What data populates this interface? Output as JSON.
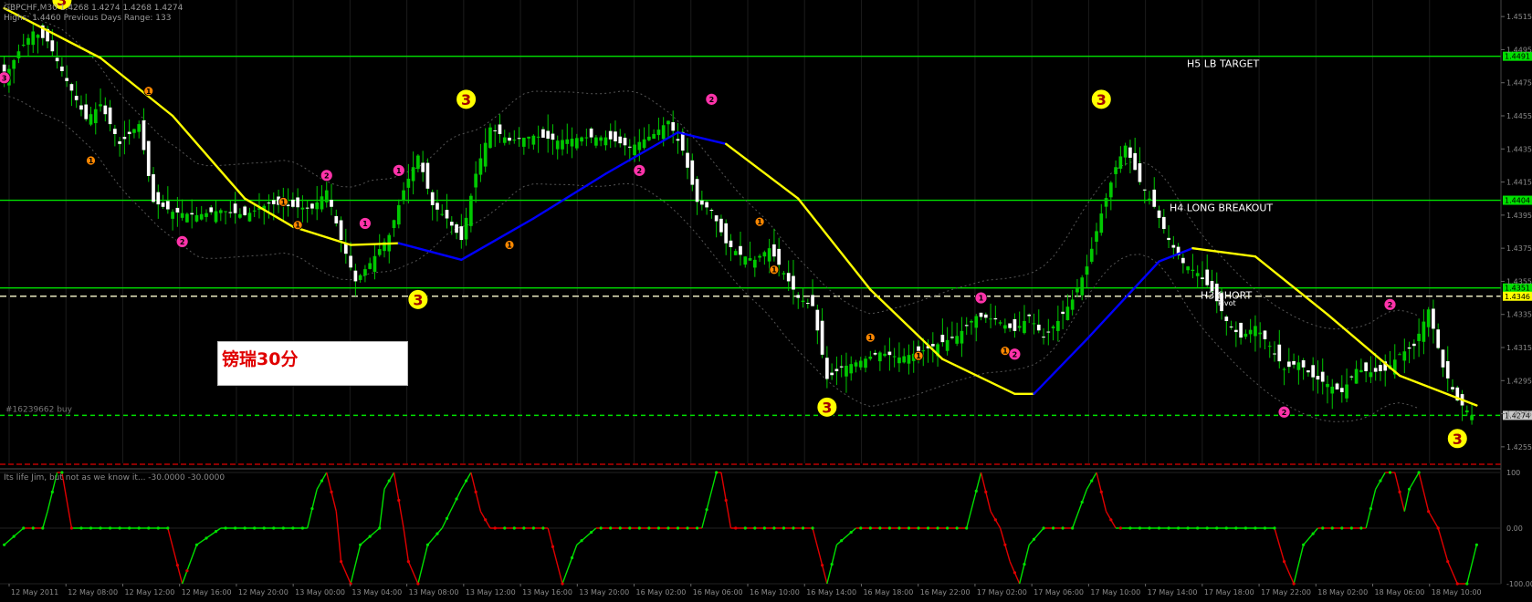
{
  "header": {
    "symbol_line": "GBPCHF,M30 1.4268 1.4274 1.4268 1.4274",
    "info_line": "Highs: 1.4460 Previous Days Range: 133"
  },
  "colors": {
    "background": "#000000",
    "bull_candle": "#00c800",
    "bear_candle": "#ffffff",
    "level_line": "#00e000",
    "ma_up": "#ffff00",
    "ma_down": "#0000ff",
    "osc_up": "#00e000",
    "osc_down": "#e00000",
    "signal_badge": "#ffff00",
    "arrow_pink": "#ff33aa",
    "arrow_orange": "#ff8800",
    "label_text": "#e00000"
  },
  "levels": {
    "h5": {
      "label": "H5 LB TARGET",
      "price": 1.4491,
      "price_text": "1.4491"
    },
    "h4": {
      "label": "H4 LONG BREAKOUT",
      "price": 1.4404,
      "price_text": "1.4404"
    },
    "h3": {
      "label": "H3 SHORT",
      "price": 1.4351,
      "price_text": "1.4351"
    },
    "pivot": {
      "label": "Pivot",
      "price": 1.4346,
      "price_text": "1.4346"
    },
    "order": {
      "label": "#16239662 buy",
      "price": 1.4274,
      "price_text": "1.4274"
    }
  },
  "label_box": {
    "text": "镑瑞30分"
  },
  "indicator": {
    "label": "Its life Jim, but not as we know it... -30.0000 -30.0000",
    "scale_labels": [
      "100",
      "0.00",
      "-100.00"
    ]
  },
  "chart_data": [
    {
      "type": "candlestick",
      "title": "GBPCHF,M30",
      "ylim": [
        1.4245,
        1.4525
      ],
      "y_ticks": [
        "1.4515",
        "1.4495",
        "1.4475",
        "1.4455",
        "1.4435",
        "1.4415",
        "1.4395",
        "1.4375",
        "1.4355",
        "1.4335",
        "1.4315",
        "1.4295",
        "1.4275",
        "1.4255"
      ],
      "y_tick_values": [
        1.4515,
        1.4495,
        1.4475,
        1.4455,
        1.4435,
        1.4415,
        1.4395,
        1.4375,
        1.4355,
        1.4335,
        1.4315,
        1.4295,
        1.4275,
        1.4255
      ],
      "x_tick_labels": [
        "12 May 2011",
        "12 May 08:00",
        "12 May 12:00",
        "12 May 16:00",
        "12 May 20:00",
        "13 May 00:00",
        "13 May 04:00",
        "13 May 08:00",
        "13 May 12:00",
        "13 May 16:00",
        "13 May 20:00",
        "16 May 02:00",
        "16 May 06:00",
        "16 May 10:00",
        "16 May 14:00",
        "16 May 18:00",
        "16 May 22:00",
        "17 May 02:00",
        "17 May 06:00",
        "17 May 10:00",
        "17 May 14:00",
        "17 May 18:00",
        "17 May 22:00",
        "18 May 02:00",
        "18 May 06:00",
        "18 May 10:00"
      ],
      "key_closes": [
        {
          "i": 0,
          "c": 1.4478
        },
        {
          "i": 3,
          "c": 1.4494
        },
        {
          "i": 6,
          "c": 1.4506
        },
        {
          "i": 9,
          "c": 1.45
        },
        {
          "i": 13,
          "c": 1.4476
        },
        {
          "i": 17,
          "c": 1.4453
        },
        {
          "i": 20,
          "c": 1.4462
        },
        {
          "i": 24,
          "c": 1.4438
        },
        {
          "i": 28,
          "c": 1.445
        },
        {
          "i": 31,
          "c": 1.4403
        },
        {
          "i": 35,
          "c": 1.4397
        },
        {
          "i": 40,
          "c": 1.4395
        },
        {
          "i": 45,
          "c": 1.4398
        },
        {
          "i": 50,
          "c": 1.4395
        },
        {
          "i": 55,
          "c": 1.4402
        },
        {
          "i": 60,
          "c": 1.44
        },
        {
          "i": 64,
          "c": 1.4399
        },
        {
          "i": 67,
          "c": 1.441
        },
        {
          "i": 70,
          "c": 1.438
        },
        {
          "i": 73,
          "c": 1.4355
        },
        {
          "i": 76,
          "c": 1.4366
        },
        {
          "i": 80,
          "c": 1.4383
        },
        {
          "i": 83,
          "c": 1.441
        },
        {
          "i": 86,
          "c": 1.4431
        },
        {
          "i": 89,
          "c": 1.4401
        },
        {
          "i": 92,
          "c": 1.4393
        },
        {
          "i": 95,
          "c": 1.438
        },
        {
          "i": 98,
          "c": 1.442
        },
        {
          "i": 101,
          "c": 1.4448
        },
        {
          "i": 105,
          "c": 1.444
        },
        {
          "i": 110,
          "c": 1.4443
        },
        {
          "i": 115,
          "c": 1.444
        },
        {
          "i": 120,
          "c": 1.4442
        },
        {
          "i": 125,
          "c": 1.4442
        },
        {
          "i": 130,
          "c": 1.4436
        },
        {
          "i": 135,
          "c": 1.4444
        },
        {
          "i": 138,
          "c": 1.4452
        },
        {
          "i": 141,
          "c": 1.4434
        },
        {
          "i": 144,
          "c": 1.4403
        },
        {
          "i": 147,
          "c": 1.4398
        },
        {
          "i": 150,
          "c": 1.4378
        },
        {
          "i": 153,
          "c": 1.4371
        },
        {
          "i": 156,
          "c": 1.4368
        },
        {
          "i": 159,
          "c": 1.4375
        },
        {
          "i": 162,
          "c": 1.436
        },
        {
          "i": 165,
          "c": 1.4345
        },
        {
          "i": 168,
          "c": 1.434
        },
        {
          "i": 171,
          "c": 1.4296
        },
        {
          "i": 174,
          "c": 1.4303
        },
        {
          "i": 178,
          "c": 1.4307
        },
        {
          "i": 182,
          "c": 1.4312
        },
        {
          "i": 186,
          "c": 1.4309
        },
        {
          "i": 190,
          "c": 1.4312
        },
        {
          "i": 194,
          "c": 1.4317
        },
        {
          "i": 198,
          "c": 1.4322
        },
        {
          "i": 202,
          "c": 1.4334
        },
        {
          "i": 206,
          "c": 1.4332
        },
        {
          "i": 210,
          "c": 1.4325
        },
        {
          "i": 213,
          "c": 1.4334
        },
        {
          "i": 216,
          "c": 1.4321
        },
        {
          "i": 219,
          "c": 1.4331
        },
        {
          "i": 222,
          "c": 1.4344
        },
        {
          "i": 225,
          "c": 1.4364
        },
        {
          "i": 228,
          "c": 1.4396
        },
        {
          "i": 231,
          "c": 1.4424
        },
        {
          "i": 233,
          "c": 1.4437
        },
        {
          "i": 236,
          "c": 1.4415
        },
        {
          "i": 239,
          "c": 1.44
        },
        {
          "i": 242,
          "c": 1.438
        },
        {
          "i": 245,
          "c": 1.4366
        },
        {
          "i": 248,
          "c": 1.436
        },
        {
          "i": 251,
          "c": 1.4349
        },
        {
          "i": 254,
          "c": 1.4331
        },
        {
          "i": 257,
          "c": 1.4321
        },
        {
          "i": 260,
          "c": 1.4328
        },
        {
          "i": 263,
          "c": 1.4316
        },
        {
          "i": 266,
          "c": 1.4302
        },
        {
          "i": 269,
          "c": 1.4306
        },
        {
          "i": 272,
          "c": 1.4297
        },
        {
          "i": 275,
          "c": 1.4293
        },
        {
          "i": 278,
          "c": 1.4288
        },
        {
          "i": 281,
          "c": 1.4302
        },
        {
          "i": 284,
          "c": 1.43
        },
        {
          "i": 287,
          "c": 1.4301
        },
        {
          "i": 290,
          "c": 1.4311
        },
        {
          "i": 293,
          "c": 1.4316
        },
        {
          "i": 296,
          "c": 1.4338
        },
        {
          "i": 299,
          "c": 1.4303
        },
        {
          "i": 302,
          "c": 1.4283
        },
        {
          "i": 305,
          "c": 1.4274
        }
      ],
      "n_bars": 307,
      "moving_average": [
        {
          "i": 0,
          "v": 1.452,
          "trend": "down"
        },
        {
          "i": 20,
          "v": 1.449,
          "trend": "down"
        },
        {
          "i": 35,
          "v": 1.4455,
          "trend": "down"
        },
        {
          "i": 50,
          "v": 1.4405,
          "trend": "down"
        },
        {
          "i": 60,
          "v": 1.4388,
          "trend": "down"
        },
        {
          "i": 72,
          "v": 1.4377,
          "trend": "down"
        },
        {
          "i": 82,
          "v": 1.4378,
          "trend": "up"
        },
        {
          "i": 95,
          "v": 1.4368,
          "trend": "up"
        },
        {
          "i": 110,
          "v": 1.4393,
          "trend": "up"
        },
        {
          "i": 125,
          "v": 1.442,
          "trend": "up"
        },
        {
          "i": 140,
          "v": 1.4445,
          "trend": "up"
        },
        {
          "i": 150,
          "v": 1.4438,
          "trend": "down"
        },
        {
          "i": 165,
          "v": 1.4405,
          "trend": "down"
        },
        {
          "i": 180,
          "v": 1.435,
          "trend": "down"
        },
        {
          "i": 195,
          "v": 1.4308,
          "trend": "down"
        },
        {
          "i": 210,
          "v": 1.4287,
          "trend": "down"
        },
        {
          "i": 214,
          "v": 1.4287,
          "trend": "up"
        },
        {
          "i": 225,
          "v": 1.432,
          "trend": "up"
        },
        {
          "i": 240,
          "v": 1.4367,
          "trend": "up"
        },
        {
          "i": 247,
          "v": 1.4375,
          "trend": "down"
        },
        {
          "i": 260,
          "v": 1.437,
          "trend": "down"
        },
        {
          "i": 275,
          "v": 1.4335,
          "trend": "down"
        },
        {
          "i": 290,
          "v": 1.4298,
          "trend": "down"
        },
        {
          "i": 306,
          "v": 1.428,
          "trend": "down"
        }
      ],
      "signals_3": [
        {
          "i": 12,
          "p": 1.4525,
          "side": "above"
        },
        {
          "i": 86,
          "p": 1.4344,
          "side": "below"
        },
        {
          "i": 96,
          "p": 1.4465,
          "side": "above"
        },
        {
          "i": 171,
          "p": 1.4279,
          "side": "below"
        },
        {
          "i": 228,
          "p": 1.4465,
          "side": "above"
        },
        {
          "i": 302,
          "p": 1.426,
          "side": "below"
        }
      ],
      "arrows": [
        {
          "i": 0,
          "p": 1.4478,
          "color": "pink",
          "label": "3"
        },
        {
          "i": 37,
          "p": 1.4379,
          "color": "pink",
          "label": "2"
        },
        {
          "i": 18,
          "p": 1.4428,
          "color": "orange",
          "label": "1"
        },
        {
          "i": 30,
          "p": 1.447,
          "color": "orange",
          "label": "1"
        },
        {
          "i": 58,
          "p": 1.4403,
          "color": "orange",
          "label": "1"
        },
        {
          "i": 61,
          "p": 1.4389,
          "color": "orange",
          "label": "1"
        },
        {
          "i": 67,
          "p": 1.4419,
          "color": "pink",
          "label": "2"
        },
        {
          "i": 75,
          "p": 1.439,
          "color": "pink",
          "label": "1"
        },
        {
          "i": 82,
          "p": 1.4422,
          "color": "pink",
          "label": "1"
        },
        {
          "i": 105,
          "p": 1.4377,
          "color": "orange",
          "label": "1"
        },
        {
          "i": 132,
          "p": 1.4422,
          "color": "pink",
          "label": "2"
        },
        {
          "i": 147,
          "p": 1.4465,
          "color": "pink",
          "label": "2"
        },
        {
          "i": 157,
          "p": 1.4391,
          "color": "orange",
          "label": "1"
        },
        {
          "i": 160,
          "p": 1.4362,
          "color": "orange",
          "label": "1"
        },
        {
          "i": 180,
          "p": 1.4321,
          "color": "orange",
          "label": "1"
        },
        {
          "i": 190,
          "p": 1.431,
          "color": "orange",
          "label": "1"
        },
        {
          "i": 203,
          "p": 1.4345,
          "color": "pink",
          "label": "1"
        },
        {
          "i": 210,
          "p": 1.4311,
          "color": "pink",
          "label": "2"
        },
        {
          "i": 208,
          "p": 1.4313,
          "color": "orange",
          "label": "1"
        },
        {
          "i": 266,
          "p": 1.4276,
          "color": "pink",
          "label": "2"
        },
        {
          "i": 288,
          "p": 1.4341,
          "color": "pink",
          "label": "2"
        }
      ]
    },
    {
      "type": "line",
      "title": "Its life Jim, but not as we know it...",
      "ylim": [
        -100,
        100
      ],
      "y_ticks": [
        "100",
        "0.00",
        "-100.00"
      ],
      "points": [
        {
          "i": 0,
          "v": -30
        },
        {
          "i": 4,
          "v": 0
        },
        {
          "i": 8,
          "v": 0
        },
        {
          "i": 9,
          "v": 30
        },
        {
          "i": 11,
          "v": 100
        },
        {
          "i": 12,
          "v": 100
        },
        {
          "i": 14,
          "v": 0
        },
        {
          "i": 34,
          "v": 0
        },
        {
          "i": 37,
          "v": -100
        },
        {
          "i": 40,
          "v": -30
        },
        {
          "i": 45,
          "v": 0
        },
        {
          "i": 63,
          "v": 0
        },
        {
          "i": 65,
          "v": 70
        },
        {
          "i": 67,
          "v": 100
        },
        {
          "i": 69,
          "v": 30
        },
        {
          "i": 70,
          "v": -60
        },
        {
          "i": 72,
          "v": -100
        },
        {
          "i": 74,
          "v": -30
        },
        {
          "i": 78,
          "v": 0
        },
        {
          "i": 79,
          "v": 70
        },
        {
          "i": 81,
          "v": 100
        },
        {
          "i": 83,
          "v": 0
        },
        {
          "i": 84,
          "v": -60
        },
        {
          "i": 86,
          "v": -100
        },
        {
          "i": 88,
          "v": -30
        },
        {
          "i": 91,
          "v": 0
        },
        {
          "i": 95,
          "v": 70
        },
        {
          "i": 97,
          "v": 100
        },
        {
          "i": 99,
          "v": 30
        },
        {
          "i": 101,
          "v": 0
        },
        {
          "i": 113,
          "v": 0
        },
        {
          "i": 116,
          "v": -100
        },
        {
          "i": 119,
          "v": -30
        },
        {
          "i": 123,
          "v": 0
        },
        {
          "i": 145,
          "v": 0
        },
        {
          "i": 148,
          "v": 100
        },
        {
          "i": 149,
          "v": 100
        },
        {
          "i": 151,
          "v": 0
        },
        {
          "i": 168,
          "v": 0
        },
        {
          "i": 171,
          "v": -100
        },
        {
          "i": 173,
          "v": -30
        },
        {
          "i": 177,
          "v": 0
        },
        {
          "i": 200,
          "v": 0
        },
        {
          "i": 203,
          "v": 100
        },
        {
          "i": 205,
          "v": 30
        },
        {
          "i": 207,
          "v": 0
        },
        {
          "i": 209,
          "v": -60
        },
        {
          "i": 211,
          "v": -100
        },
        {
          "i": 213,
          "v": -30
        },
        {
          "i": 216,
          "v": 0
        },
        {
          "i": 222,
          "v": 0
        },
        {
          "i": 225,
          "v": 70
        },
        {
          "i": 227,
          "v": 100
        },
        {
          "i": 229,
          "v": 30
        },
        {
          "i": 231,
          "v": 0
        },
        {
          "i": 264,
          "v": 0
        },
        {
          "i": 266,
          "v": -60
        },
        {
          "i": 268,
          "v": -100
        },
        {
          "i": 270,
          "v": -30
        },
        {
          "i": 273,
          "v": 0
        },
        {
          "i": 283,
          "v": 0
        },
        {
          "i": 285,
          "v": 70
        },
        {
          "i": 287,
          "v": 100
        },
        {
          "i": 289,
          "v": 100
        },
        {
          "i": 291,
          "v": 30
        },
        {
          "i": 292,
          "v": 70
        },
        {
          "i": 294,
          "v": 100
        },
        {
          "i": 296,
          "v": 30
        },
        {
          "i": 298,
          "v": 0
        },
        {
          "i": 300,
          "v": -60
        },
        {
          "i": 302,
          "v": -100
        },
        {
          "i": 304,
          "v": -100
        },
        {
          "i": 306,
          "v": -30
        }
      ]
    }
  ]
}
